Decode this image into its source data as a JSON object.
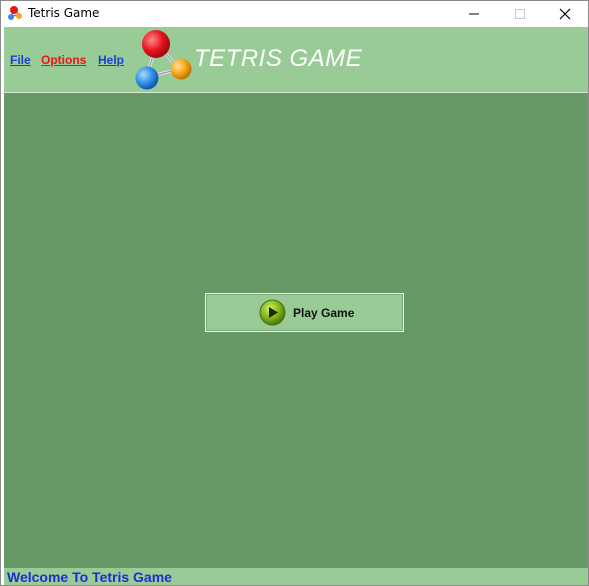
{
  "window": {
    "title": "Tetris Game"
  },
  "menu": {
    "file": "File",
    "options": "Options",
    "help": "Help"
  },
  "header": {
    "title": "TETRIS GAME"
  },
  "main": {
    "play_button_label": "Play Game"
  },
  "status": {
    "text": "Welcome To Tetris Game"
  },
  "colors": {
    "header_bg": "#99cb97",
    "main_bg": "#679966",
    "menu_link": "#1a3fd3",
    "menu_active": "#e8141a",
    "status_text": "#1a2fd3"
  },
  "icons": {
    "app": "molecule-icon",
    "logo": "molecule-logo-icon",
    "play": "play-icon",
    "minimize": "minimize-icon",
    "maximize": "maximize-icon",
    "close": "close-icon"
  }
}
